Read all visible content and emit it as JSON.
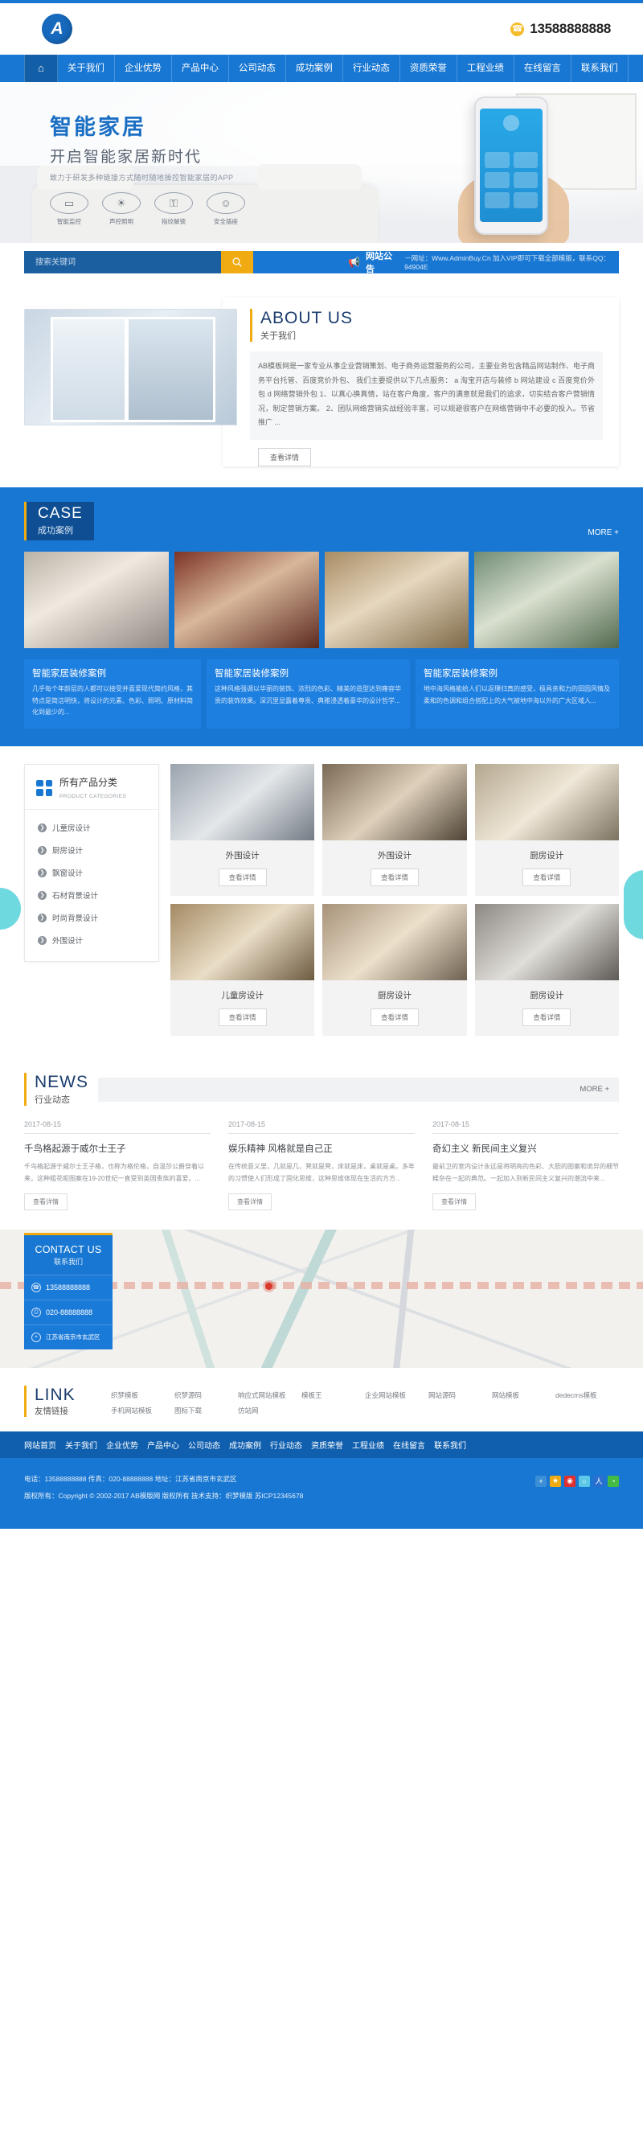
{
  "header": {
    "logo_letter": "A",
    "phone": "13588888888"
  },
  "nav": {
    "home_icon": "home-icon",
    "items": [
      "关于我们",
      "企业优势",
      "产品中心",
      "公司动态",
      "成功案例",
      "行业动态",
      "资质荣誉",
      "工程业绩",
      "在线留言",
      "联系我们"
    ]
  },
  "banner": {
    "title": "智能家居",
    "subtitle": "开启智能家居新时代",
    "tagline": "致力于研发多种链接方式随时随地操控智能家居的APP",
    "features": [
      {
        "icon": "camera-icon",
        "glyph": "▭",
        "label": "智能监控"
      },
      {
        "icon": "lamp-icon",
        "glyph": "☀",
        "label": "声控照明"
      },
      {
        "icon": "lock-icon",
        "glyph": "⚿",
        "label": "指纹解锁"
      },
      {
        "icon": "socket-icon",
        "glyph": "☺",
        "label": "安全插座"
      }
    ]
  },
  "search": {
    "placeholder": "搜索关键词",
    "button_icon": "search-icon",
    "notice_icon": "megaphone-icon",
    "notice_title": "网站公告",
    "notice_text": "－网址：Www.AdminBuy.Cn 加入VIP即可下载全部模版，联系QQ：94904E"
  },
  "about": {
    "title_en": "ABOUT US",
    "title_cn": "关于我们",
    "body": "AB模板网是一家专业从事企业营销策划、电子商务运营服务的公司，主要业务包含精品网站制作、电子商务平台托管、百度竞价外包、 我们主要提供以下几点服务： a 淘宝开店与装修 b 网站建设 c 百度竞价外包 d 网络营销外包 1、以真心换真情，站在客户角度，客户的满意就是我们的追求，切实结合客户营销情况，制定营销方案。 2、团队网络营销实战经验丰富，可以规避很客户在网络营销中不必要的投入。节省推广 ...",
    "more_label": "查看详情"
  },
  "case": {
    "title_en": "CASE",
    "title_cn": "成功案例",
    "more_label": "MORE +",
    "cards": [
      {
        "title": "智能家居装修案例",
        "desc": "几乎每个年龄层的人都可以接受并喜爱现代简约风格，其特点是简洁明快，将设计的元素、色彩、照明、原材料简化到最少的..."
      },
      {
        "title": "智能家居装修案例",
        "desc": "这种风格强调以华丽的装饰、浓烈的色彩、精美的造型达到雍容华贵的装饰效果。深沉里显露着尊贵、典雅浸透着豪华的设计哲学..."
      },
      {
        "title": "智能家居装修案例",
        "desc": "地中海风格能给人们以返璞归真的感受，极具亲和力的田园风情及柔和的色调和组合搭配上的大气被地中海以外的广大区域人..."
      }
    ]
  },
  "products": {
    "panel_cn": "所有产品分类",
    "panel_en": "PRODUCT CATEGORIES",
    "categories": [
      "儿童房设计",
      "厨房设计",
      "飘窗设计",
      "石材背景设计",
      "时尚背景设计",
      "外围设计"
    ],
    "detail_label": "查看详情",
    "items": [
      {
        "title": "外围设计"
      },
      {
        "title": "外围设计"
      },
      {
        "title": "厨房设计"
      },
      {
        "title": "儿童房设计"
      },
      {
        "title": "厨房设计"
      },
      {
        "title": "厨房设计"
      }
    ]
  },
  "news": {
    "title_en": "NEWS",
    "title_cn": "行业动态",
    "more_label": "MORE +",
    "detail_label": "查看详情",
    "items": [
      {
        "date": "2017-08-15",
        "title": "千鸟格起源于威尔士王子",
        "desc": "千鸟格起源于威尔士王子格，也称为格伦格，自温莎公爵穿着以来，这种粗花呢图案在19-20世纪一直受到英国贵族的喜爱。..."
      },
      {
        "date": "2017-08-15",
        "title": "娱乐精神 风格就是自己正",
        "desc": "在传统意义里，几就是几，凳就是凳，床就是床，桌就是桌。多年的习惯使人们形成了固化思维，这种思维体现在生活的方方..."
      },
      {
        "date": "2017-08-15",
        "title": "奇幻主义 新民间主义复兴",
        "desc": "最前卫的室内设计永远是将明亮的色彩、大胆的图案和诡异的细节糅杂在一起的典范。一起加入到新民间主义复兴的潮流中来..."
      }
    ]
  },
  "contact": {
    "title_en": "CONTACT US",
    "title_cn": "联系我们",
    "rows": [
      {
        "icon": "phone-icon",
        "glyph": "☎",
        "text": "13588888888"
      },
      {
        "icon": "fax-icon",
        "glyph": "⎙",
        "text": "020-88888888"
      },
      {
        "icon": "location-icon",
        "glyph": "⌖",
        "text": "江苏省南京市玄武区"
      }
    ]
  },
  "links": {
    "title_en": "LINK",
    "title_cn": "友情链接",
    "items": [
      "织梦模板",
      "织梦源码",
      "响应式网站模板",
      "模板王",
      "企业网站模板",
      "网站源码",
      "网站模板",
      "dedecms模板",
      "手机网站模板",
      "图标下载",
      "仿站网"
    ]
  },
  "footer": {
    "nav": [
      "网站首页",
      "关于我们",
      "企业优势",
      "产品中心",
      "公司动态",
      "成功案例",
      "行业动态",
      "资质荣誉",
      "工程业绩",
      "在线留言",
      "联系我们"
    ],
    "info_line": "电话：13588888888    传真：020-88888888    地址：江苏省南京市玄武区",
    "copyright": "版权所有：Copyright © 2002-2017 AB模版网 版权所有    技术支持：织梦模版    苏ICP12345678",
    "share_icons": [
      {
        "name": "share-plus-icon",
        "glyph": "+",
        "color": "#3b8fd6"
      },
      {
        "name": "favorite-star-icon",
        "glyph": "★",
        "color": "#f0ab12"
      },
      {
        "name": "weibo-icon",
        "glyph": "◉",
        "color": "#e02f2f"
      },
      {
        "name": "qzone-icon",
        "glyph": "○",
        "color": "#5bc8e8"
      },
      {
        "name": "renren-icon",
        "glyph": "人",
        "color": "#2a6fd0"
      },
      {
        "name": "wechat-icon",
        "glyph": "◔",
        "color": "#44bb44"
      }
    ]
  },
  "colors": {
    "primary": "#1877d2",
    "primary_dark": "#0f5fae",
    "accent": "#f0ab12",
    "navy": "#1b3d6d"
  }
}
